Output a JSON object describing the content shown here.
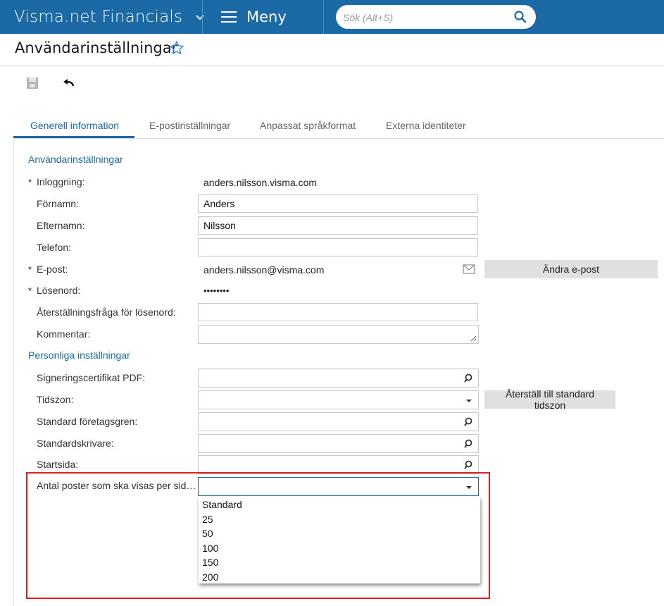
{
  "header": {
    "app_title": "Visma.net Financials",
    "menu_label": "Meny",
    "search_placeholder": "Sök (Alt+S)"
  },
  "page": {
    "title": "Användarinställningar"
  },
  "tabs": [
    {
      "label": "Generell information",
      "active": true
    },
    {
      "label": "E-postinställningar",
      "active": false
    },
    {
      "label": "Anpassat språkformat",
      "active": false
    },
    {
      "label": "Externa identiteter",
      "active": false
    }
  ],
  "sections": {
    "user": "Användarinställningar",
    "personal": "Personliga inställningar"
  },
  "fields": {
    "login": {
      "label": "Inloggning:",
      "value": "anders.nilsson.visma.com",
      "required": "*"
    },
    "firstname": {
      "label": "Förnamn:",
      "value": "Anders"
    },
    "lastname": {
      "label": "Efternamn:",
      "value": "Nilsson"
    },
    "phone": {
      "label": "Telefon:",
      "value": ""
    },
    "email": {
      "label": "E-post:",
      "value": "anders.nilsson@visma.com",
      "required": "*"
    },
    "password": {
      "label": "Lösenord:",
      "value": "••••••••",
      "required": "*"
    },
    "reset_question": {
      "label": "Återställningsfråga för lösenord:",
      "value": ""
    },
    "comment": {
      "label": "Kommentar:",
      "value": ""
    },
    "sign_cert": {
      "label": "Signeringscertifikat PDF:",
      "value": ""
    },
    "timezone": {
      "label": "Tidszon:",
      "value": ""
    },
    "default_branch": {
      "label": "Standard företagsgren:",
      "value": ""
    },
    "default_printer": {
      "label": "Standardskrivare:",
      "value": ""
    },
    "start_page": {
      "label": "Startsida:",
      "value": ""
    },
    "rows_per_page": {
      "label": "Antal poster som ska visas per sid…",
      "value": ""
    }
  },
  "buttons": {
    "change_email": "Ändra e-post",
    "reset_timezone": "Återställ till standard tidszon"
  },
  "rows_per_page_options": [
    "Standard",
    "25",
    "50",
    "100",
    "150",
    "200"
  ],
  "colors": {
    "brand": "#1b6aa5",
    "highlight": "#e02020"
  }
}
